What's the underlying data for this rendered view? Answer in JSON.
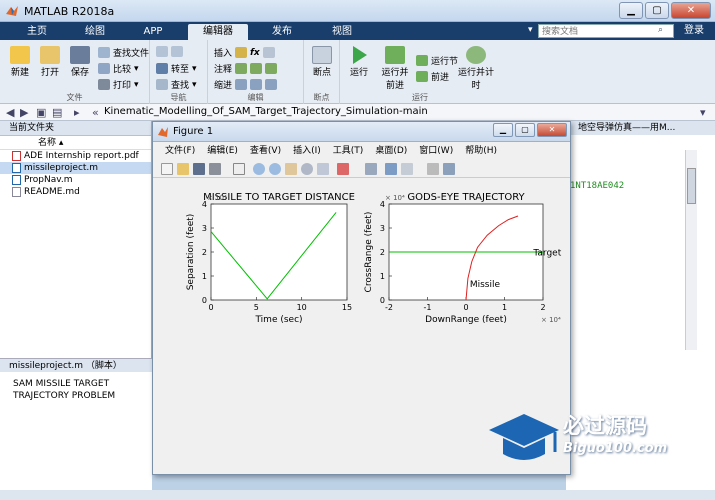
{
  "window": {
    "title": "MATLAB R2018a"
  },
  "tabs": [
    "主页",
    "绘图",
    "APP",
    "编辑器",
    "发布",
    "视图"
  ],
  "active_tab": "编辑器",
  "search": {
    "placeholder": "搜索文档"
  },
  "login_label": "登录",
  "ribbon": {
    "file_group": {
      "label": "文件",
      "new": "新建",
      "open": "打开",
      "save": "保存",
      "find_files": "查找文件",
      "compare": "比较",
      "print": "打印"
    },
    "nav_group": {
      "label": "导航",
      "goto": "转至",
      "find": "查找"
    },
    "edit_group": {
      "label": "编辑",
      "insert": "插入",
      "comment": "注释",
      "indent": "缩进",
      "fx": "fx"
    },
    "bp_group": {
      "label": "断点",
      "breakpoints": "断点"
    },
    "run_group": {
      "label": "运行",
      "run": "运行",
      "run_advance": "运行并前进",
      "run_section": "运行节",
      "advance": "前进",
      "run_time": "运行并计时"
    }
  },
  "address": {
    "path": "Kinematic_Modelling_Of_SAM_Target_Trajectory_Simulation-main"
  },
  "current_folder": {
    "header": "当前文件夹",
    "column": "名称",
    "files": [
      "ADE Internship report.pdf",
      "missileproject.m",
      "PropNav.m",
      "README.md"
    ],
    "selected": "missileproject.m"
  },
  "details": {
    "header": "missileproject.m （脚本）",
    "text_line1": "SAM MISSILE TARGET",
    "text_line2": "TRAJECTORY PROBLEM"
  },
  "editor": {
    "tab_text": "地空导弹仿真——用M...",
    "code_fragment": "1NT18AE042"
  },
  "figure": {
    "title": "Figure 1",
    "menu": [
      "文件(F)",
      "编辑(E)",
      "查看(V)",
      "插入(I)",
      "工具(T)",
      "桌面(D)",
      "窗口(W)",
      "帮助(H)"
    ]
  },
  "chart_data": [
    {
      "type": "line",
      "title": "MISSILE TO TARGET DISTANCE",
      "xlabel": "Time (sec)",
      "ylabel": "Separation (feet)",
      "xlim": [
        0,
        15
      ],
      "ylim": [
        0,
        4
      ],
      "xticks": [
        "0",
        "5",
        "10",
        "15"
      ],
      "yticks": [
        "0",
        "1",
        "2",
        "3",
        "4"
      ],
      "y_exponent": "× 10⁴",
      "series": [
        {
          "color": "#00c000",
          "x": [
            0,
            6.2,
            13.8
          ],
          "y": [
            2.85,
            0.05,
            3.65
          ]
        }
      ]
    },
    {
      "type": "line",
      "title": "GODS-EYE TRAJECTORY",
      "xlabel": "DownRange (feet)",
      "ylabel": "CrossRange (feet)",
      "xlim": [
        -2,
        2
      ],
      "ylim": [
        0,
        4
      ],
      "xticks": [
        "-2",
        "-1",
        "0",
        "1",
        "2"
      ],
      "yticks": [
        "0",
        "1",
        "2",
        "3",
        "4"
      ],
      "x_exponent": "× 10⁴",
      "y_exponent": "× 10⁴",
      "annotations": {
        "target": "Target",
        "missile": "Missile"
      },
      "series": [
        {
          "color": "#00c000",
          "x": [
            -2,
            2
          ],
          "y": [
            2.0,
            2.0
          ]
        },
        {
          "color": "#e02020",
          "x": [
            0.0,
            0.05,
            0.15,
            0.3,
            0.55,
            0.85,
            1.1,
            1.35
          ],
          "y": [
            0.0,
            0.9,
            1.6,
            2.2,
            2.7,
            3.1,
            3.35,
            3.5
          ]
        }
      ]
    }
  ],
  "watermark": {
    "main": "必过源码",
    "sub": "Biguo100.com"
  },
  "colors": {
    "tabbar": "#1a3e6b",
    "ribbon": "#e6ecf3",
    "selection": "#c5daf2"
  }
}
